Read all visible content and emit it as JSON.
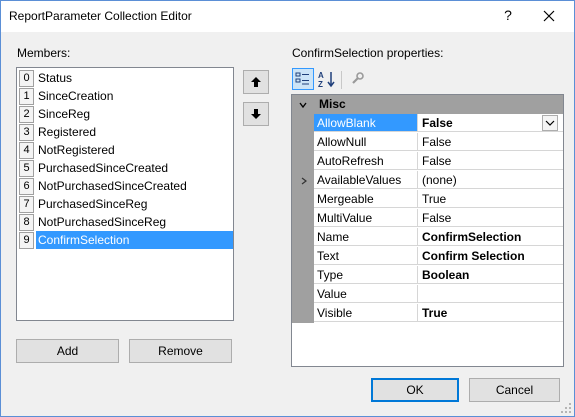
{
  "window": {
    "title": "ReportParameter Collection Editor",
    "help_label": "?"
  },
  "members": {
    "label": "Members:",
    "items": [
      {
        "index": "0",
        "name": "Status"
      },
      {
        "index": "1",
        "name": "SinceCreation"
      },
      {
        "index": "2",
        "name": "SinceReg"
      },
      {
        "index": "3",
        "name": "Registered"
      },
      {
        "index": "4",
        "name": "NotRegistered"
      },
      {
        "index": "5",
        "name": "PurchasedSinceCreated"
      },
      {
        "index": "6",
        "name": "NotPurchasedSinceCreated"
      },
      {
        "index": "7",
        "name": "PurchasedSinceReg"
      },
      {
        "index": "8",
        "name": "NotPurchasedSinceReg"
      },
      {
        "index": "9",
        "name": "ConfirmSelection"
      }
    ],
    "selected": "ConfirmSelection"
  },
  "buttons": {
    "add": "Add",
    "remove": "Remove",
    "ok": "OK",
    "cancel": "Cancel"
  },
  "properties": {
    "label": "ConfirmSelection properties:",
    "category": "Misc",
    "rows": [
      {
        "name": "AllowBlank",
        "value": "False",
        "bold": true,
        "selected": true
      },
      {
        "name": "AllowNull",
        "value": "False"
      },
      {
        "name": "AutoRefresh",
        "value": "False"
      },
      {
        "name": "AvailableValues",
        "value": "(none)",
        "expandable": true
      },
      {
        "name": "Mergeable",
        "value": "True"
      },
      {
        "name": "MultiValue",
        "value": "False"
      },
      {
        "name": "Name",
        "value": "ConfirmSelection",
        "bold": true
      },
      {
        "name": "Text",
        "value": "Confirm Selection",
        "bold": true
      },
      {
        "name": "Type",
        "value": "Boolean",
        "bold": true
      },
      {
        "name": "Value",
        "value": ""
      },
      {
        "name": "Visible",
        "value": "True",
        "bold": true
      }
    ]
  },
  "colors": {
    "selection": "#3399ff",
    "border": "#5b8fd6",
    "gutter": "#a0a0a0"
  }
}
